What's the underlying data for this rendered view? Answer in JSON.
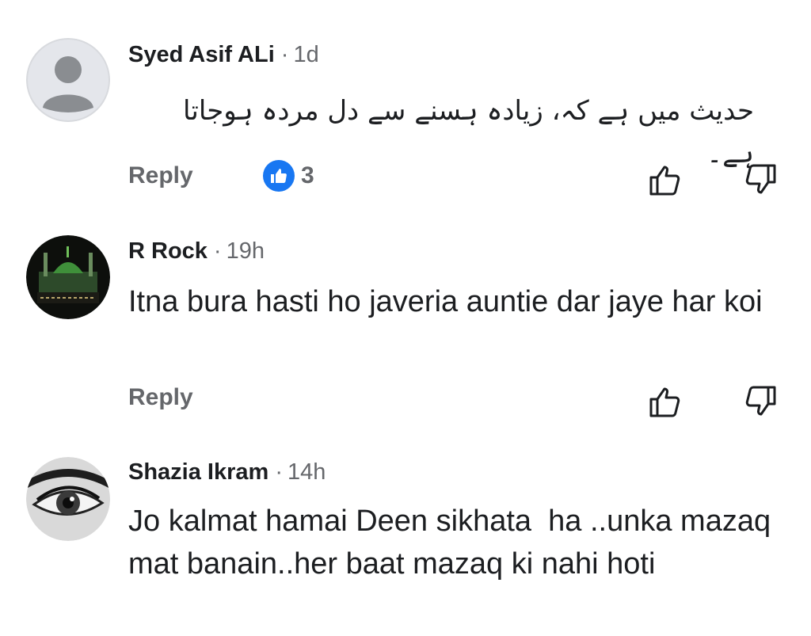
{
  "comments": [
    {
      "author": "Syed Asif ALi",
      "separator": "·",
      "time": "1d",
      "text": "حدیث میں ہے کہ، زیادہ ہسنے سے دل مردہ ہوجاتا ہے۔",
      "reply_label": "Reply",
      "like_count": "3",
      "avatar": "default-person-icon"
    },
    {
      "author": "R Rock",
      "separator": "·",
      "time": "19h",
      "text": "Itna bura hasti ho javeria auntie dar jaye har koi",
      "reply_label": "Reply",
      "avatar": "green-dome-image"
    },
    {
      "author": "Shazia Ikram",
      "separator": "·",
      "time": "14h",
      "text": "Jo kalmat hamai Deen sikhata  ha ..unka mazaq mat banain..her baat mazaq ki nahi hoti",
      "avatar": "eye-closeup-image"
    }
  ],
  "colors": {
    "text": "#1c1e21",
    "secondary": "#65676b",
    "like_blue": "#1877f2"
  }
}
